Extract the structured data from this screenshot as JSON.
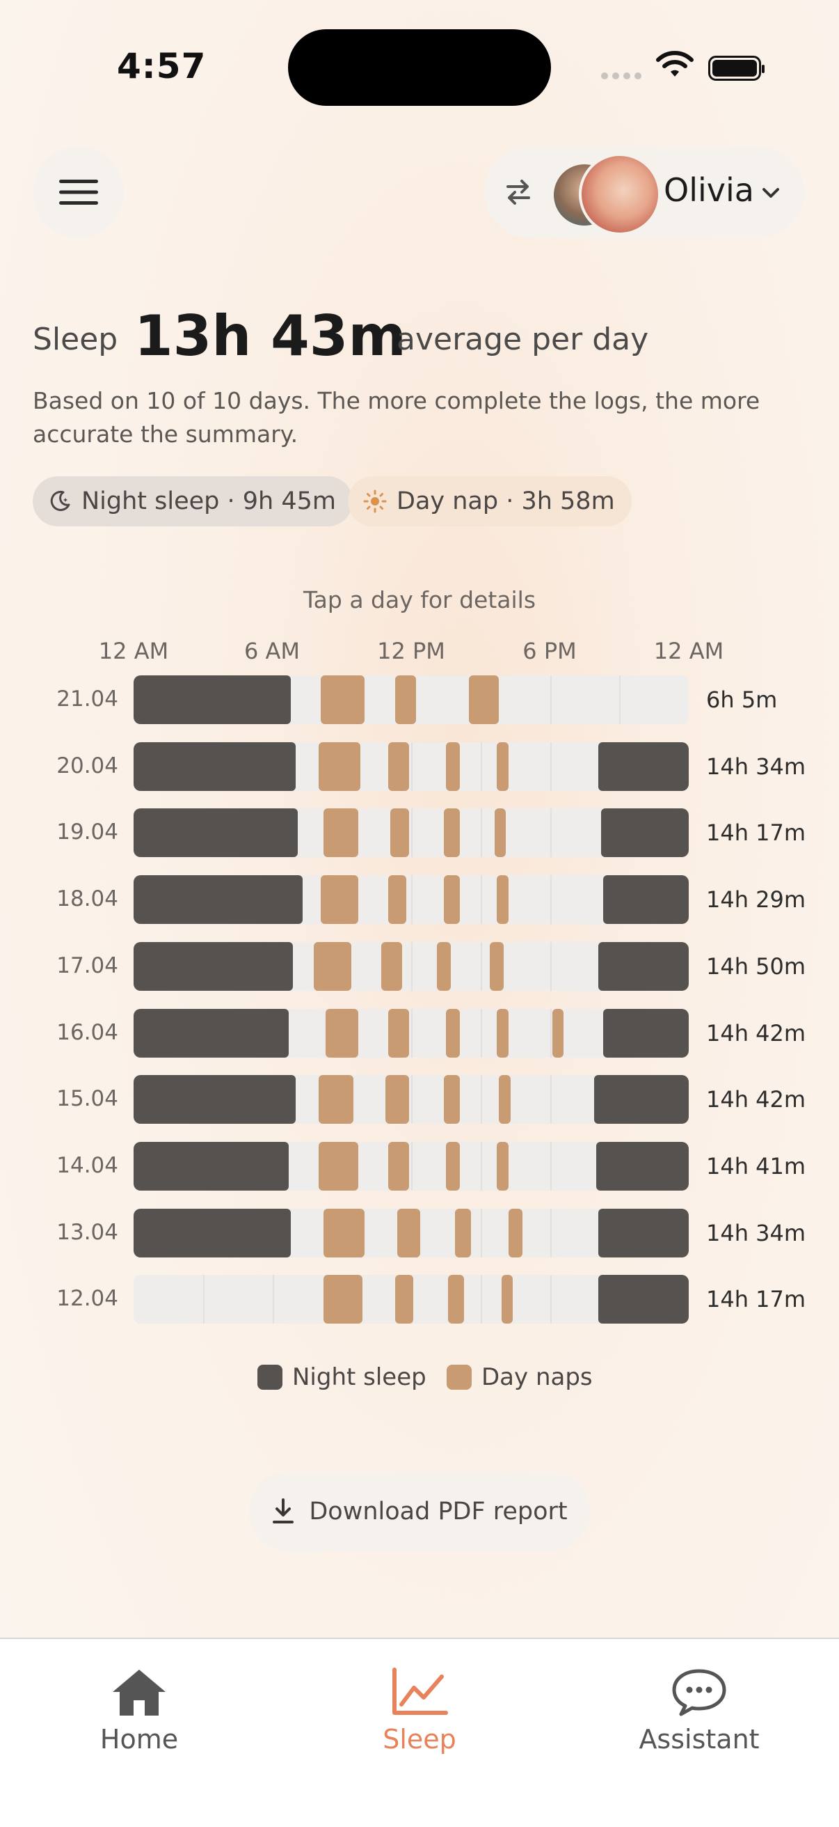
{
  "status_bar": {
    "time": "4:57"
  },
  "header": {
    "child_name": "Olivia"
  },
  "summary": {
    "metric": "Sleep",
    "average_value": "13h 43m",
    "average_suffix": "average per day",
    "subtitle": "Based on 10 of 10 days. The more complete the logs, the more accurate the summary.",
    "night_chip": "Night sleep · 9h 45m",
    "day_chip": "Day nap · 3h 58m"
  },
  "chart": {
    "hint": "Tap a day for details",
    "x_ticks": [
      "12 AM",
      "6 AM",
      "12 PM",
      "6 PM",
      "12 AM"
    ],
    "colors": {
      "night": "#56524f",
      "nap": "#c99b72"
    },
    "legend": {
      "night": "Night sleep",
      "nap": "Day naps"
    }
  },
  "chart_data": {
    "type": "bar",
    "x_axis": "time of day (hours 0–24)",
    "xlim": [
      0,
      24
    ],
    "rows": [
      {
        "date": "21.04",
        "total": "6h 5m",
        "night": [
          [
            0,
            6.8
          ]
        ],
        "naps": [
          [
            8.1,
            10.0
          ],
          [
            11.3,
            12.2
          ],
          [
            14.5,
            15.8
          ]
        ]
      },
      {
        "date": "20.04",
        "total": "14h 34m",
        "night": [
          [
            0,
            7.0
          ],
          [
            20.1,
            24
          ]
        ],
        "naps": [
          [
            8.0,
            9.8
          ],
          [
            11.0,
            11.9
          ],
          [
            13.5,
            14.1
          ],
          [
            15.7,
            16.2
          ]
        ]
      },
      {
        "date": "19.04",
        "total": "14h 17m",
        "night": [
          [
            0,
            7.1
          ],
          [
            20.2,
            24
          ]
        ],
        "naps": [
          [
            8.2,
            9.7
          ],
          [
            11.1,
            11.9
          ],
          [
            13.4,
            14.1
          ],
          [
            15.6,
            16.1
          ]
        ]
      },
      {
        "date": "18.04",
        "total": "14h 29m",
        "night": [
          [
            0,
            7.3
          ],
          [
            20.3,
            24
          ]
        ],
        "naps": [
          [
            8.1,
            9.7
          ],
          [
            11.0,
            11.8
          ],
          [
            13.4,
            14.1
          ],
          [
            15.7,
            16.2
          ]
        ]
      },
      {
        "date": "17.04",
        "total": "14h 50m",
        "night": [
          [
            0,
            6.9
          ],
          [
            20.1,
            24
          ]
        ],
        "naps": [
          [
            7.8,
            9.4
          ],
          [
            10.7,
            11.6
          ],
          [
            13.1,
            13.7
          ],
          [
            15.4,
            16.0
          ]
        ]
      },
      {
        "date": "16.04",
        "total": "14h 42m",
        "night": [
          [
            0,
            6.7
          ],
          [
            20.3,
            24
          ]
        ],
        "naps": [
          [
            8.3,
            9.7
          ],
          [
            11.0,
            11.9
          ],
          [
            13.5,
            14.1
          ],
          [
            15.7,
            16.2
          ],
          [
            18.1,
            18.6
          ]
        ]
      },
      {
        "date": "15.04",
        "total": "14h 42m",
        "night": [
          [
            0,
            7.0
          ],
          [
            19.9,
            24
          ]
        ],
        "naps": [
          [
            8.0,
            9.5
          ],
          [
            10.9,
            11.9
          ],
          [
            13.4,
            14.1
          ],
          [
            15.8,
            16.3
          ]
        ]
      },
      {
        "date": "14.04",
        "total": "14h 41m",
        "night": [
          [
            0,
            6.7
          ],
          [
            20.0,
            24
          ]
        ],
        "naps": [
          [
            8.0,
            9.7
          ],
          [
            11.0,
            11.9
          ],
          [
            13.5,
            14.1
          ],
          [
            15.7,
            16.2
          ]
        ]
      },
      {
        "date": "13.04",
        "total": "14h 34m",
        "night": [
          [
            0,
            6.8
          ],
          [
            20.1,
            24
          ]
        ],
        "naps": [
          [
            8.2,
            10.0
          ],
          [
            11.4,
            12.4
          ],
          [
            13.9,
            14.6
          ],
          [
            16.2,
            16.8
          ]
        ]
      },
      {
        "date": "12.04",
        "total": "14h 17m",
        "night": [
          [
            20.1,
            24
          ]
        ],
        "naps": [
          [
            8.2,
            9.9
          ],
          [
            11.3,
            12.1
          ],
          [
            13.6,
            14.3
          ],
          [
            15.9,
            16.4
          ]
        ]
      }
    ]
  },
  "actions": {
    "pdf": "Download PDF report"
  },
  "tabs": [
    {
      "label": "Home",
      "icon": "home-icon"
    },
    {
      "label": "Sleep",
      "icon": "chart-icon"
    },
    {
      "label": "Assistant",
      "icon": "chat-icon"
    }
  ]
}
